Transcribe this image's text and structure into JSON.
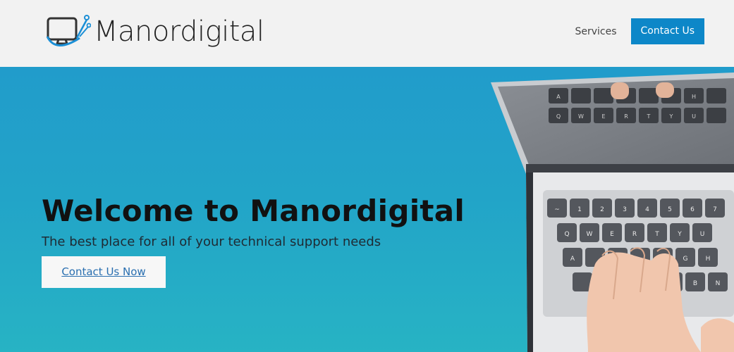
{
  "brand": {
    "name": "Manordigital",
    "logo_icon": "monitor-circuit-icon"
  },
  "nav": {
    "services_label": "Services",
    "contact_label": "Contact Us"
  },
  "hero": {
    "title": "Welcome to Manordigital",
    "subtitle": "The best place for all of your technical support needs",
    "cta_label": "Contact Us Now"
  },
  "colors": {
    "accent": "#0d87c8",
    "hero_top": "#219ccb",
    "hero_bottom": "#27b3c4",
    "header_bg": "#f2f2f2"
  },
  "laptop_keys": {
    "screen_row1": [
      "A",
      "",
      "",
      "",
      "",
      "",
      "H"
    ],
    "screen_row2": [
      "Q",
      "W",
      "E",
      "R",
      "T",
      "Y",
      "U"
    ],
    "num_row": [
      "~",
      "1",
      "2",
      "3",
      "4",
      "5",
      "6",
      "7"
    ],
    "q_row": [
      "Q",
      "W",
      "E",
      "R",
      "T",
      "Y",
      "U"
    ],
    "a_row": [
      "A",
      "",
      "",
      "",
      "",
      "G",
      "H"
    ],
    "z_row": [
      "",
      "",
      "",
      "",
      "",
      "B",
      "N"
    ]
  }
}
